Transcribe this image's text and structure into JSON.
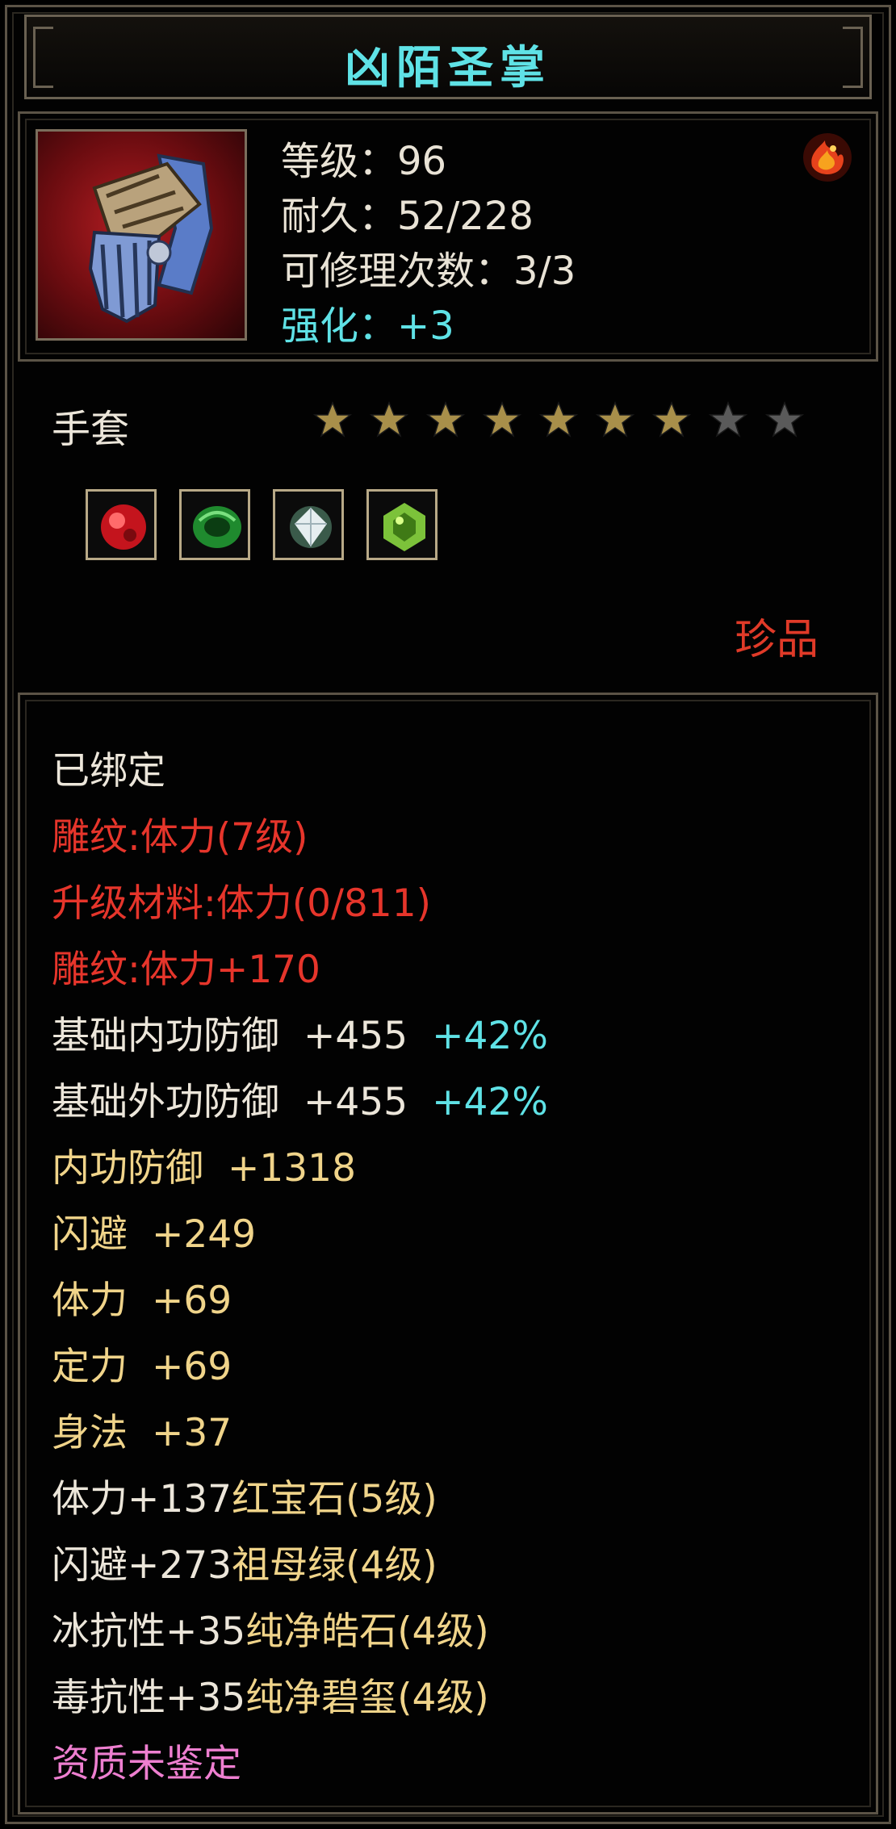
{
  "title": "凶陌圣掌",
  "stats": {
    "level": "等级：96",
    "durability": "耐久：52/228",
    "repairs": "可修理次数：3/3",
    "enhance": "强化：+3"
  },
  "item_type": "手套",
  "stars": {
    "filled": 7,
    "total": 9
  },
  "rarity": "珍品",
  "attributes": {
    "bound": "已绑定",
    "engrave_level": "雕纹:体力(7级)",
    "upgrade_material": "升级材料:体力(0/811)",
    "engrave_bonus": "雕纹:体力+170",
    "base_inner_def": {
      "label": "基础内功防御",
      "value": "+455",
      "pct": "+42%"
    },
    "base_outer_def": {
      "label": "基础外功防御",
      "value": "+455",
      "pct": "+42%"
    },
    "inner_def": {
      "label": "内功防御",
      "value": "+1318"
    },
    "dodge": {
      "label": "闪避",
      "value": "+249"
    },
    "stamina": {
      "label": "体力",
      "value": "+69"
    },
    "focus": {
      "label": "定力",
      "value": "+69"
    },
    "agility": {
      "label": "身法",
      "value": "+37"
    },
    "gems": [
      {
        "prefix": "体力+137",
        "name": "红宝石",
        "grade": "(5级)"
      },
      {
        "prefix": "闪避+273",
        "name": "祖母绿",
        "grade": "(4级)"
      },
      {
        "prefix": "冰抗性+35",
        "name": "纯净皓石",
        "grade": "(4级)"
      },
      {
        "prefix": "毒抗性+35",
        "name": "纯净碧玺",
        "grade": "(4级)"
      }
    ],
    "aptitude": "资质未鉴定"
  },
  "colors": {
    "cyan": "#5fe2e6",
    "red": "#e6352b",
    "gold": "#f0d48a",
    "pink": "#ee7fd0",
    "star_filled": "#a88f4a",
    "star_empty": "#5a5a5a"
  }
}
